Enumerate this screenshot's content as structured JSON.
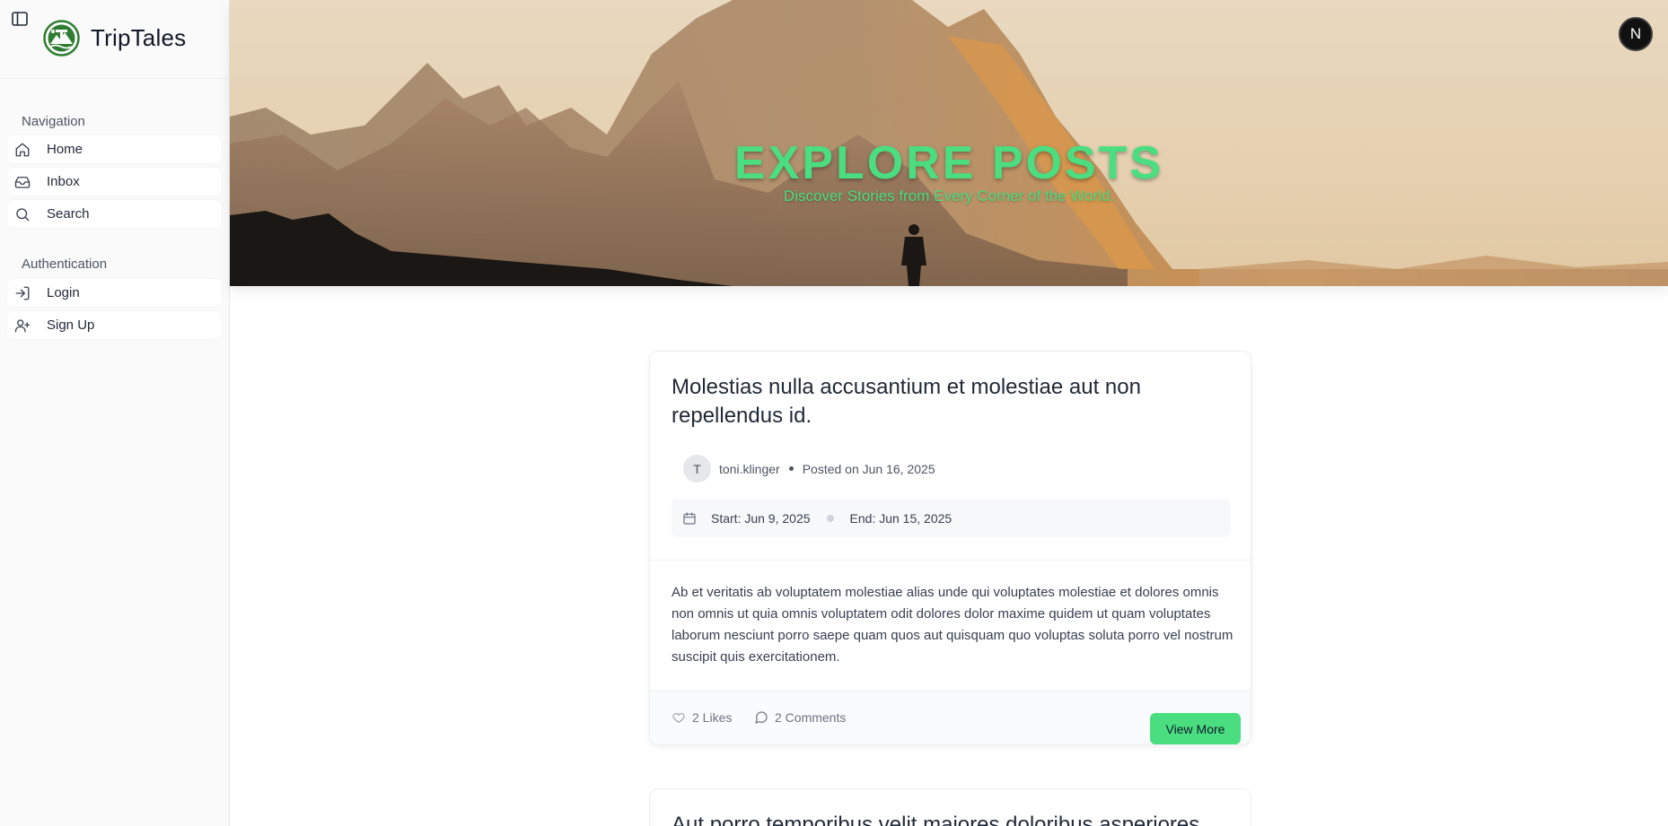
{
  "brand": {
    "name": "TripTales"
  },
  "sidebar": {
    "groups": [
      {
        "label": "Navigation",
        "items": [
          {
            "label": "Home",
            "icon": "home-icon"
          },
          {
            "label": "Inbox",
            "icon": "inbox-icon"
          },
          {
            "label": "Search",
            "icon": "search-icon"
          }
        ]
      },
      {
        "label": "Authentication",
        "items": [
          {
            "label": "Login",
            "icon": "login-icon"
          },
          {
            "label": "Sign Up",
            "icon": "user-plus-icon"
          }
        ]
      }
    ]
  },
  "hero": {
    "title": "EXPLORE POSTS",
    "subtitle": "Discover Stories from Every Corner of the World."
  },
  "user_avatar": {
    "initial": "N"
  },
  "posts": [
    {
      "title": "Molestias nulla accusantium et molestiae aut non repellendus id.",
      "author_initial": "T",
      "author": "toni.klinger",
      "posted": "Posted on Jun 16, 2025",
      "start": "Start: Jun 9, 2025",
      "end": "End: Jun 15, 2025",
      "body": "Ab et veritatis ab voluptatem molestiae alias unde qui voluptates molestiae et dolores omnis non omnis ut quia omnis voluptatem odit dolores dolor maxime quidem ut quam voluptates laborum nesciunt porro saepe quam quos aut quisquam quo voluptas soluta porro vel nostrum suscipit quis exercitationem.",
      "likes": "2 Likes",
      "comments": "2 Comments",
      "cta": "View More"
    },
    {
      "title": "Aut porro temporibus velit maiores doloribus asperiores"
    }
  ],
  "colors": {
    "accent": "#4ade80",
    "sidebar_bg": "#fafafa",
    "logo_green": "#2f7d32"
  }
}
